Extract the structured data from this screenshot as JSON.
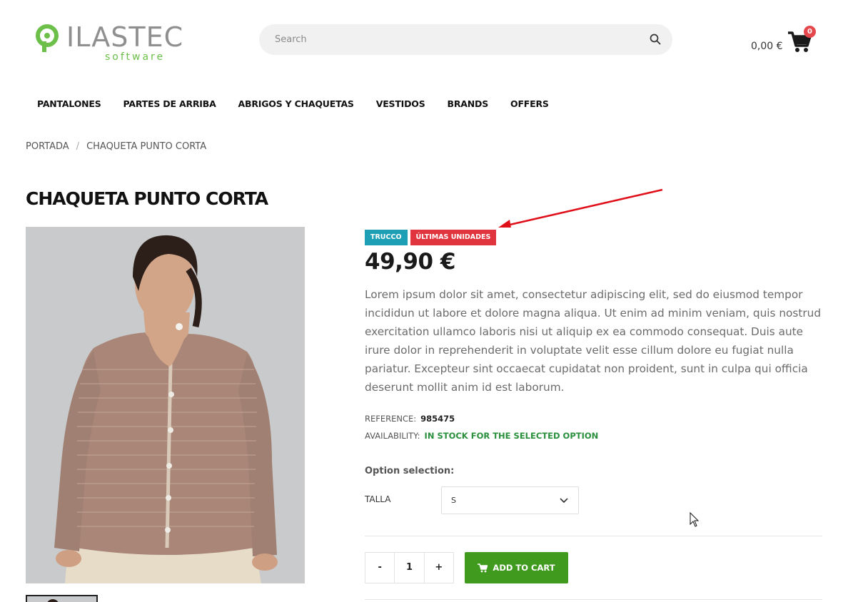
{
  "header": {
    "logo_text": "ILASTEC",
    "logo_sub": "software",
    "search_placeholder": "Search",
    "cart_amount": "0,00 €",
    "cart_count": "0"
  },
  "nav": [
    "PANTALONES",
    "PARTES DE ARRIBA",
    "ABRIGOS Y CHAQUETAS",
    "VESTIDOS",
    "BRANDS",
    "OFFERS"
  ],
  "breadcrumb": [
    "PORTADA",
    "CHAQUETA PUNTO CORTA"
  ],
  "product": {
    "title": "CHAQUETA PUNTO CORTA",
    "badges": [
      "TRUCCO",
      "ÚLTIMAS UNIDADES"
    ],
    "price": "49,90 €",
    "description": "Lorem ipsum dolor sit amet, consectetur adipiscing elit, sed do eiusmod tempor incididun ut labore et dolore magna aliqua. Ut enim ad minim veniam, quis nostrud exercitation ullamco laboris nisi ut aliquip ex ea commodo consequat. Duis aute irure dolor in reprehenderit in voluptate velit esse cillum dolore eu fugiat nulla pariatur. Excepteur sint occaecat cupidatat non proident, sunt in culpa qui officia deserunt mollit anim id est laborum.",
    "reference_label": "REFERENCE:",
    "reference_value": "985475",
    "availability_label": "AVAILABILITY:",
    "availability_value": "IN STOCK FOR THE SELECTED OPTION",
    "option_title": "Option selection:",
    "option_label": "TALLA",
    "option_value": "S",
    "qty_minus": "-",
    "qty_value": "1",
    "qty_plus": "+",
    "add_to_cart": "ADD TO CART"
  },
  "colors": {
    "badge_blue": "#1d9fb6",
    "badge_red": "#e0353f",
    "add_to_cart": "#3f9a1e",
    "stock_green": "#2a8f3c",
    "logo_green": "#6cc04a",
    "logo_gray": "#8f8f8f"
  }
}
